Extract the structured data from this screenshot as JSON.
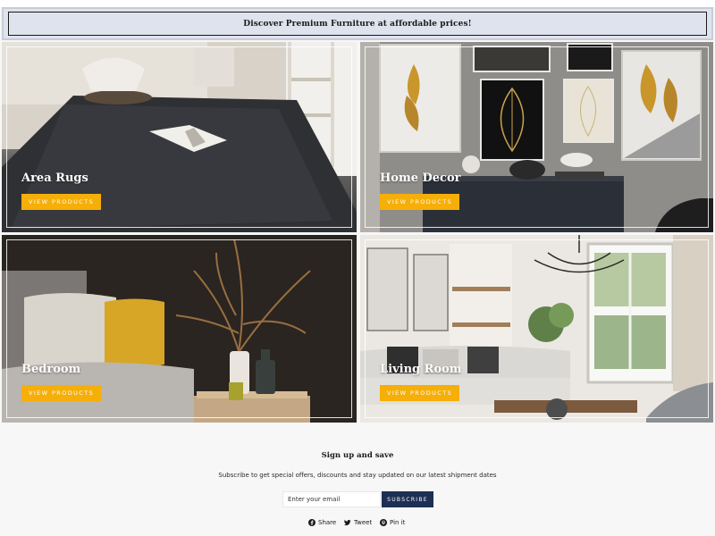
{
  "banner": {
    "text": "Discover Premium Furniture at affordable prices!"
  },
  "collections": [
    {
      "title": "Area Rugs",
      "button": "VIEW PRODUCTS"
    },
    {
      "title": "Home Decor",
      "button": "VIEW PRODUCTS"
    },
    {
      "title": "Bedroom",
      "button": "VIEW PRODUCTS"
    },
    {
      "title": "Living Room",
      "button": "VIEW PRODUCTS"
    }
  ],
  "signup": {
    "title": "Sign up and save",
    "description": "Subscribe to get special offers, discounts and stay updated on our latest shipment dates",
    "email_placeholder": "Enter your email",
    "button": "SUBSCRIBE"
  },
  "social": [
    {
      "label": "Share",
      "icon": "facebook-icon"
    },
    {
      "label": "Tweet",
      "icon": "twitter-icon"
    },
    {
      "label": "Pin it",
      "icon": "pinterest-icon"
    }
  ],
  "colors": {
    "accent": "#f6ae08",
    "subscribe": "#1d2f54",
    "banner_bg": "#dfe3ee"
  }
}
